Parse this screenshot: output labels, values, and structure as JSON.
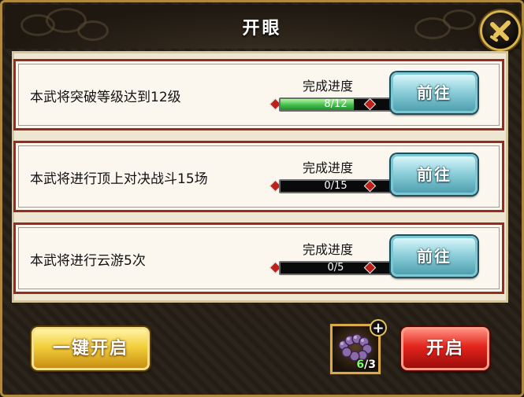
{
  "dialog": {
    "title": "开眼"
  },
  "tasks": [
    {
      "label": "本武将突破等级达到12级",
      "progress_caption": "完成进度",
      "progress_text": "8/12",
      "progress_fraction": 0.667,
      "button_label": "前往"
    },
    {
      "label": "本武将进行顶上对决战斗15场",
      "progress_caption": "完成进度",
      "progress_text": "0/15",
      "progress_fraction": 0,
      "button_label": "前往"
    },
    {
      "label": "本武将进行云游5次",
      "progress_caption": "完成进度",
      "progress_text": "0/5",
      "progress_fraction": 0,
      "button_label": "前往"
    }
  ],
  "footer": {
    "one_key_label": "一键开启",
    "open_label": "开启",
    "item": {
      "have": "6",
      "separator": "/",
      "need": "3",
      "icon": "bead-bracelet-icon"
    },
    "add_icon": "plus-icon"
  },
  "colors": {
    "progress_fill": "#3fbf4a",
    "go_button": "#8fd0db",
    "one_key_button": "#f2cf3c",
    "open_button": "#e3241c",
    "frame_red": "#9a2a20"
  }
}
